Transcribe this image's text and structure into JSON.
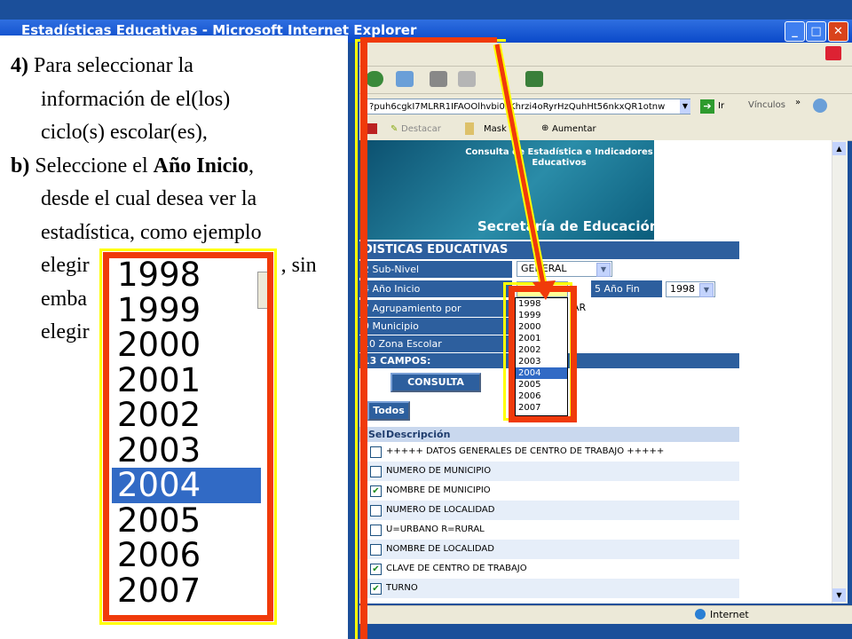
{
  "window": {
    "title": "Estadísticas Educativas - Microsoft Internet Explorer"
  },
  "address_bar": {
    "url": "?puh6cgkI7MLRR1IFAOOlhvbi0zKhrzi4oRyrHzQuhHt56nkxQR1otnw",
    "go_label": "Ir",
    "links_label": "Vínculos"
  },
  "toolbar": {
    "highlight_label": "Destacar",
    "mask_label": "Mask",
    "zoom_label": "Aumentar"
  },
  "banner": {
    "consult_title": "Consulta de Estadística e Indicadores Educativos",
    "secretaria": "Secretaría de Educación"
  },
  "form": {
    "header": "DISTICAS EDUCATIVAS",
    "rows": [
      {
        "label": "2 Sub-Nivel"
      },
      {
        "label": "4 Año Inicio"
      },
      {
        "label": "7 Agrupamiento por"
      },
      {
        "label": "9 Municipio"
      },
      {
        "label": "10 Zona Escolar"
      }
    ],
    "subnivel_value": "GENERAL",
    "anio_fin_label": "5 Año Fin",
    "anio_fin_value": "1998",
    "agrupamiento_partial": "AR",
    "campos_header": "13 CAMPOS:",
    "consulta_button": "CONSULTA",
    "todos_button": "Todos"
  },
  "year_options": [
    "1998",
    "1999",
    "2000",
    "2001",
    "2002",
    "2003",
    "2004",
    "2005",
    "2006",
    "2007"
  ],
  "selected_year": "2004",
  "table": {
    "col_sel": "Sel",
    "col_desc": "Descripción",
    "rows": [
      {
        "desc": "+++++ DATOS GENERALES DE CENTRO DE TRABAJO +++++",
        "checked": false
      },
      {
        "desc": "NUMERO DE MUNICIPIO",
        "checked": false
      },
      {
        "desc": "NOMBRE DE MUNICIPIO",
        "checked": true
      },
      {
        "desc": "NUMERO DE LOCALIDAD",
        "checked": false
      },
      {
        "desc": "U=URBANO R=RURAL",
        "checked": false
      },
      {
        "desc": "NOMBRE DE LOCALIDAD",
        "checked": false
      },
      {
        "desc": "CLAVE DE CENTRO DE TRABAJO",
        "checked": true
      },
      {
        "desc": "TURNO",
        "checked": true
      }
    ]
  },
  "status": {
    "zone": "Internet"
  },
  "instructions": {
    "line1_num": "4)",
    "line1_text": "Para seleccionar la",
    "line2": "información de el(los)",
    "line3": "ciclo(s) escolar(es),",
    "line4_num": "b)",
    "line4_pre": "Seleccione el",
    "line4_bold": "Año Inicio",
    "line4_post": ",",
    "line5": "desde el cual desea ver la",
    "line6": "estadística, como ejemplo",
    "line7_start": "elegir",
    "line7_end": ", sin",
    "line8_start": "emba",
    "line9_start": "elegir"
  },
  "colors": {
    "highlight_red": "#f03a0a",
    "highlight_yellow": "#ffff00",
    "selection_blue": "#316ac5",
    "form_blue": "#2d5f9e"
  }
}
